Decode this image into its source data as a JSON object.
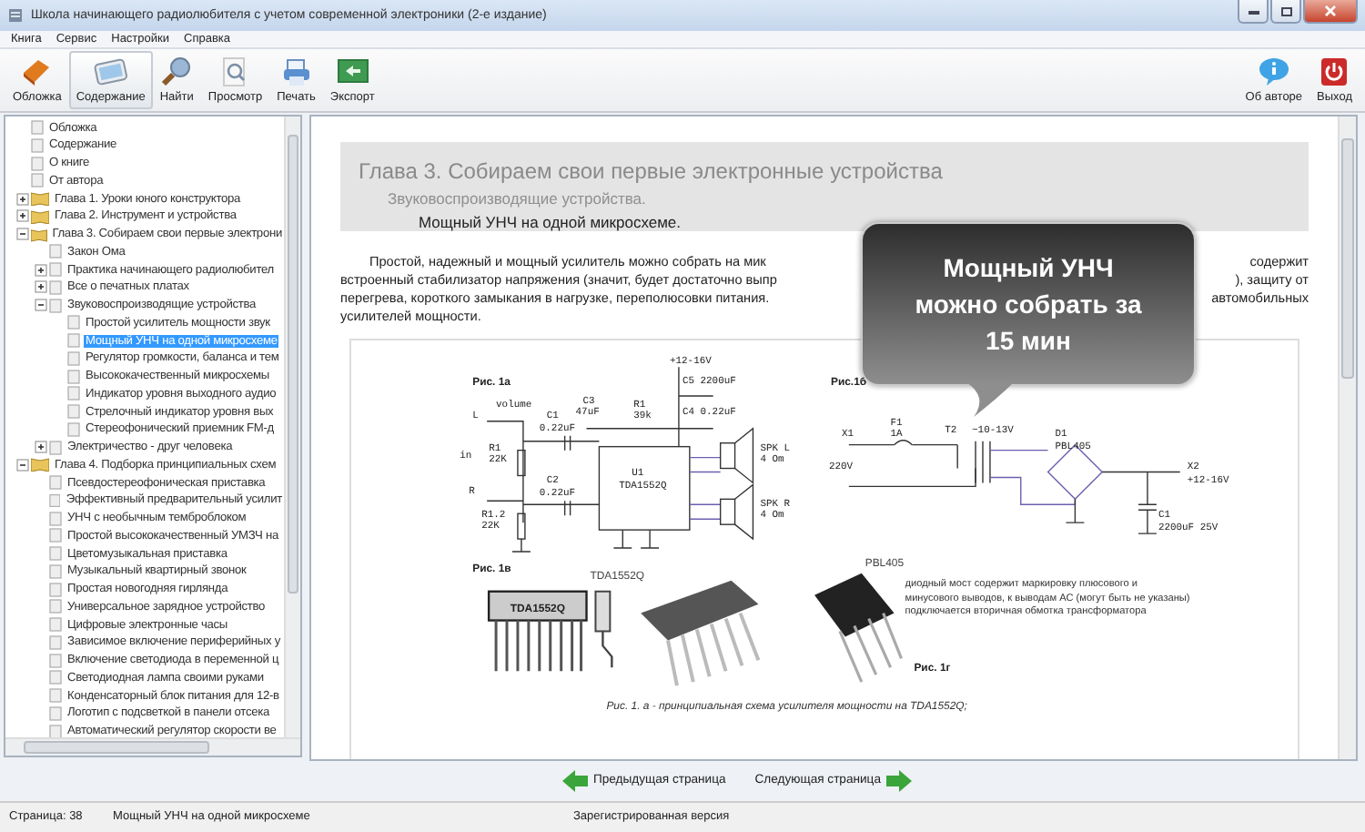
{
  "window": {
    "title": "Школа начинающего радиолюбителя с учетом современной электроники (2-е издание)"
  },
  "menu": [
    "Книга",
    "Сервис",
    "Настройки",
    "Справка"
  ],
  "toolbar": {
    "left": [
      {
        "label": "Обложка",
        "kind": "book",
        "selected": false
      },
      {
        "label": "Содержание",
        "kind": "contents",
        "selected": true
      },
      {
        "label": "Найти",
        "kind": "find",
        "selected": false
      },
      {
        "label": "Просмотр",
        "kind": "preview",
        "selected": false
      },
      {
        "label": "Печать",
        "kind": "print",
        "selected": false
      },
      {
        "label": "Экспорт",
        "kind": "export",
        "selected": false
      }
    ],
    "right": [
      {
        "label": "Об авторе",
        "kind": "about",
        "selected": false
      },
      {
        "label": "Выход",
        "kind": "exit",
        "selected": false
      }
    ]
  },
  "tree": [
    {
      "label": "Обложка",
      "kind": "page",
      "selected": false
    },
    {
      "label": "Содержание",
      "kind": "page",
      "selected": false
    },
    {
      "label": "О книге",
      "kind": "page",
      "selected": false
    },
    {
      "label": "От автора",
      "kind": "page",
      "selected": false
    },
    {
      "label": "Глава 1. Уроки юного конструктора",
      "kind": "book",
      "selected": false,
      "expanded": false
    },
    {
      "label": "Глава 2. Инструмент и устройства",
      "kind": "book",
      "selected": false,
      "expanded": false
    },
    {
      "label": "Глава 3. Собираем свои первые электрони",
      "kind": "book",
      "selected": false,
      "expanded": true,
      "children": [
        {
          "label": "Закон Ома",
          "kind": "page",
          "selected": false
        },
        {
          "label": "Практика начинающего радиолюбител",
          "kind": "page",
          "selected": false,
          "expanded": false
        },
        {
          "label": "Все о печатных платах",
          "kind": "page",
          "selected": false,
          "expanded": false
        },
        {
          "label": "Звуковоспроизводящие устройства",
          "kind": "page",
          "selected": false,
          "expanded": true,
          "children": [
            {
              "label": "Простой усилитель мощности звук",
              "kind": "page",
              "selected": false
            },
            {
              "label": "Мощный УНЧ на одной микросхеме",
              "kind": "page",
              "selected": true
            },
            {
              "label": "Регулятор громкости, баланса и тем",
              "kind": "page",
              "selected": false
            },
            {
              "label": "Высококачественный микросхемы",
              "kind": "page",
              "selected": false
            },
            {
              "label": "Индикатор уровня выходного аудио",
              "kind": "page",
              "selected": false
            },
            {
              "label": "Стрелочный индикатор уровня вых",
              "kind": "page",
              "selected": false
            },
            {
              "label": "Стереофонический приемник FM-д",
              "kind": "page",
              "selected": false
            }
          ]
        },
        {
          "label": "Электричество - друг человека",
          "kind": "page",
          "selected": false,
          "expanded": false
        }
      ]
    },
    {
      "label": "Глава 4. Подборка принципиальных схем",
      "kind": "book",
      "selected": false,
      "expanded": true,
      "children": [
        {
          "label": "Псевдостереофоническая приставка",
          "kind": "page",
          "selected": false
        },
        {
          "label": "Эффективный предварительный усилит",
          "kind": "page",
          "selected": false
        },
        {
          "label": "УНЧ с необычным темброблоком",
          "kind": "page",
          "selected": false
        },
        {
          "label": "Простой высококачественный УМЗЧ на",
          "kind": "page",
          "selected": false
        },
        {
          "label": "Цветомузыкальная приставка",
          "kind": "page",
          "selected": false
        },
        {
          "label": "Музыкальный квартирный звонок",
          "kind": "page",
          "selected": false
        },
        {
          "label": "Простая новогодняя гирлянда",
          "kind": "page",
          "selected": false
        },
        {
          "label": "Универсальное зарядное устройство",
          "kind": "page",
          "selected": false
        },
        {
          "label": "Цифровые электронные часы",
          "kind": "page",
          "selected": false
        },
        {
          "label": "Зависимое включение периферийных у",
          "kind": "page",
          "selected": false
        },
        {
          "label": "Включение светодиода в переменной ц",
          "kind": "page",
          "selected": false
        },
        {
          "label": "Светодиодная лампа своими руками",
          "kind": "page",
          "selected": false
        },
        {
          "label": "Конденсаторный блок питания для 12-в",
          "kind": "page",
          "selected": false
        },
        {
          "label": "Логотип с подсветкой в панели отсека",
          "kind": "page",
          "selected": false
        },
        {
          "label": "Автоматический регулятор скорости ве",
          "kind": "page",
          "selected": false
        }
      ]
    }
  ],
  "document": {
    "chapter": "Глава 3. Собираем свои первые электронные устройства",
    "section": "Звуковоспроизводящие устройства.",
    "article": "Мощный УНЧ на одной микросхеме.",
    "paragraph_lines": [
      {
        "left": "Простой, надежный и мощный усилитель можно собрать на мик",
        "right": "содержит"
      },
      {
        "left": "встроенный стабилизатор напряжения (значит, будет достаточно выпр",
        "right": "), защиту от"
      },
      {
        "left": "перегрева, короткого замыкания в нагрузке, переполюсовки питания.",
        "right": "автомобильных"
      },
      {
        "left": "усилителей мощности."
      }
    ],
    "figure": {
      "schematic_a": {
        "title": "Рис. 1а",
        "labels": [
          "+12-16V",
          "C5 2200uF",
          "C3",
          "47uF",
          "R1",
          "39k",
          "C4 0.22uF",
          "L",
          "volume",
          "in",
          "R1",
          "22K",
          "R",
          "R1.2",
          "22K",
          "C1",
          "0.22uF",
          "C2",
          "0.22uF",
          "U1",
          "TDA1552Q",
          "SPK L",
          "4 Om",
          "SPK R",
          "4 Om"
        ]
      },
      "schematic_b": {
        "title": "Рис.1б",
        "labels": [
          "X1",
          "220V",
          "F1",
          "1A",
          "T2",
          "~10-13V",
          "D1",
          "PBL405",
          "X2",
          "+12-16V",
          "C1",
          "2200uF 25V"
        ]
      },
      "photos": {
        "title": "Рис. 1в",
        "chip_marking": "TDA1552Q",
        "chip_label": "TDA1552Q",
        "bridge_label": "PBL405",
        "note": "диодный мост содержит маркировку плюсового и минусового выводов, к выводам АС (могут быть не указаны) подключается вторичная обмотка трансформатора",
        "note_title": "Рис. 1г"
      },
      "caption": "Рис. 1. а - принципиальная схема усилителя мощности на TDA1552Q;"
    }
  },
  "callout": {
    "text": "Мощный УНЧ можно собрать за 15 мин"
  },
  "nav": [
    {
      "label": "Предыдущая страница",
      "kind": "prev"
    },
    {
      "label": "Следующая страница",
      "kind": "next"
    }
  ],
  "status_bar": [
    "Страница: 38",
    "Мощный УНЧ на одной микросхеме",
    "Зарегистрированная версия"
  ]
}
